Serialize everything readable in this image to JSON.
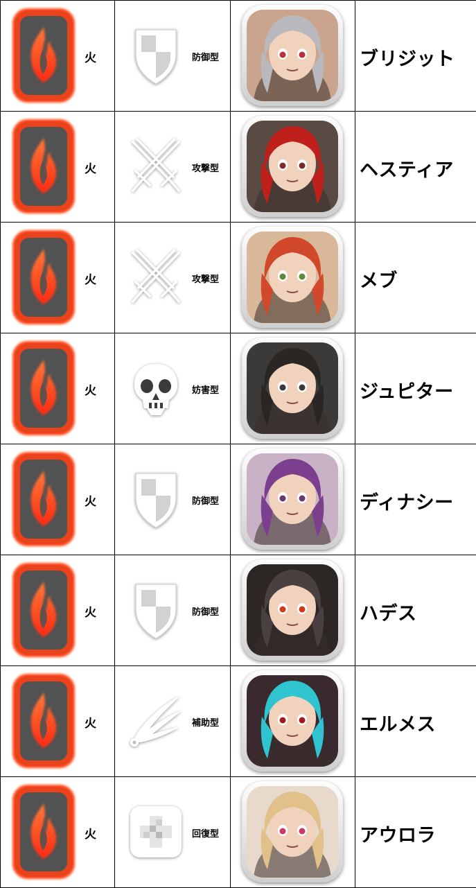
{
  "rows": [
    {
      "element": "火",
      "type_icon": "shield-icon",
      "type": "防御型",
      "name": "ブリジット",
      "colors": {
        "bg": "#caa48c",
        "hair": "#b9b9bd",
        "eye": "#b8323a"
      }
    },
    {
      "element": "火",
      "type_icon": "crossed-swords-icon",
      "type": "攻撃型",
      "name": "ヘスティア",
      "colors": {
        "bg": "#5a4a44",
        "hair": "#c0201c",
        "eye": "#7a2a2a"
      }
    },
    {
      "element": "火",
      "type_icon": "crossed-swords-icon",
      "type": "攻撃型",
      "name": "メブ",
      "colors": {
        "bg": "#d9b89a",
        "hair": "#d2482a",
        "eye": "#5f8a3a"
      }
    },
    {
      "element": "火",
      "type_icon": "skull-icon",
      "type": "妨害型",
      "name": "ジュピター",
      "colors": {
        "bg": "#3c3a38",
        "hair": "#2a2624",
        "eye": "#3a3a3a"
      }
    },
    {
      "element": "火",
      "type_icon": "shield-icon",
      "type": "防御型",
      "name": "ディナシー",
      "colors": {
        "bg": "#c9b2c6",
        "hair": "#7b3f8e",
        "eye": "#6a3a6a"
      }
    },
    {
      "element": "火",
      "type_icon": "shield-icon",
      "type": "防御型",
      "name": "ハデス",
      "colors": {
        "bg": "#2c2624",
        "hair": "#4a4040",
        "eye": "#d03a1a"
      }
    },
    {
      "element": "火",
      "type_icon": "wing-icon",
      "type": "補助型",
      "name": "エルメス",
      "colors": {
        "bg": "#3a2a30",
        "hair": "#2fc4cf",
        "eye": "#a01c1c"
      }
    },
    {
      "element": "火",
      "type_icon": "cross-icon",
      "type": "回復型",
      "name": "アウロラ",
      "colors": {
        "bg": "#e7d9cc",
        "hair": "#e2c08a",
        "eye": "#c83a60"
      }
    }
  ]
}
